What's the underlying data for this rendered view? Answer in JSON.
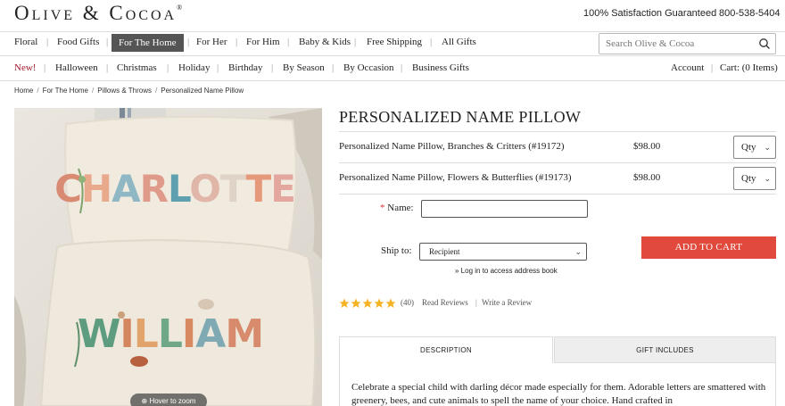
{
  "header": {
    "logo": "Olive & Cocoa",
    "logo_mark": "®",
    "satisfaction": "100% Satisfaction Guaranteed",
    "phone": "800-538-5404"
  },
  "nav_primary": {
    "items": [
      {
        "label": "Floral"
      },
      {
        "label": "Food Gifts"
      },
      {
        "label": "For The Home",
        "active": true
      },
      {
        "label": "For Her"
      },
      {
        "label": "For Him"
      },
      {
        "label": "Baby & Kids"
      },
      {
        "label": "Free Shipping"
      },
      {
        "label": "All Gifts"
      }
    ],
    "search_placeholder": "Search Olive & Cocoa"
  },
  "nav_secondary": {
    "items": [
      {
        "label": "New!"
      },
      {
        "label": "Halloween"
      },
      {
        "label": "Christmas"
      },
      {
        "label": "Holiday"
      },
      {
        "label": "Birthday"
      },
      {
        "label": "By Season"
      },
      {
        "label": "By Occasion"
      },
      {
        "label": "Business Gifts"
      }
    ],
    "account": "Account",
    "cart": "Cart: (0 Items)"
  },
  "breadcrumb": [
    "Home",
    "For The Home",
    "Pillows & Throws",
    "Personalized Name Pillow"
  ],
  "product": {
    "title": "PERSONALIZED NAME PILLOW",
    "image_names": [
      "CHARLOTTE",
      "WILLIAM"
    ],
    "zoom_hint": "Hover to zoom",
    "variants": [
      {
        "name": "Personalized Name Pillow, Branches & Critters (#19172)",
        "price": "$98.00",
        "qty_label": "Qty"
      },
      {
        "name": "Personalized Name Pillow, Flowers & Butterflies (#19173)",
        "price": "$98.00",
        "qty_label": "Qty"
      }
    ],
    "name_label": "Name:",
    "name_required_mark": "*",
    "name_value": "",
    "ship_label": "Ship to:",
    "ship_value": "Recipient",
    "login_link": "» Log in to access address book",
    "add_to_cart": "ADD TO CART",
    "rating": 5,
    "review_count": "(40)",
    "read_reviews": "Read Reviews",
    "write_review": "Write a Review",
    "tabs": {
      "description": "DESCRIPTION",
      "gift_includes": "GIFT INCLUDES"
    },
    "description": "Celebrate a special child with darling décor made especially for them. Adorable letters are smattered with greenery, bees, and cute animals to spell the name of your choice. Hand crafted in"
  },
  "colors": {
    "accent_red": "#e0493c",
    "nav_active_bg": "#555555",
    "star": "#f5b325",
    "new_red": "#a5182b"
  }
}
